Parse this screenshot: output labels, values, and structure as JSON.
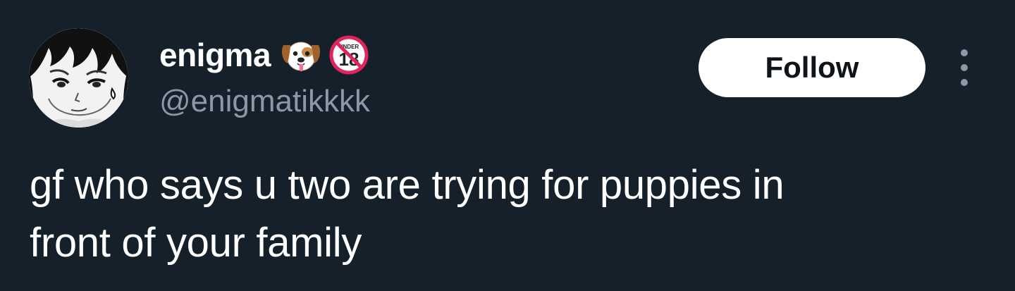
{
  "tweet": {
    "author": {
      "display_name": "enigma",
      "handle": "@enigmatikkkk",
      "avatar": "manga-portrait-avatar",
      "badges": [
        {
          "icon": "dog-face-icon",
          "kind": "emoji"
        },
        {
          "icon": "no-under-18-icon",
          "kind": "emoji",
          "label": "UNDER",
          "number": "18"
        }
      ]
    },
    "follow_label": "Follow",
    "more_icon": "vertical-ellipsis-icon",
    "text": "gf who says u two are trying for puppies in\nfront of your family"
  },
  "colors": {
    "background": "#15202b",
    "primary_text": "#ffffff",
    "secondary_text": "#8b98a5",
    "follow_button_bg": "#ffffff",
    "follow_button_text": "#0f1419"
  }
}
